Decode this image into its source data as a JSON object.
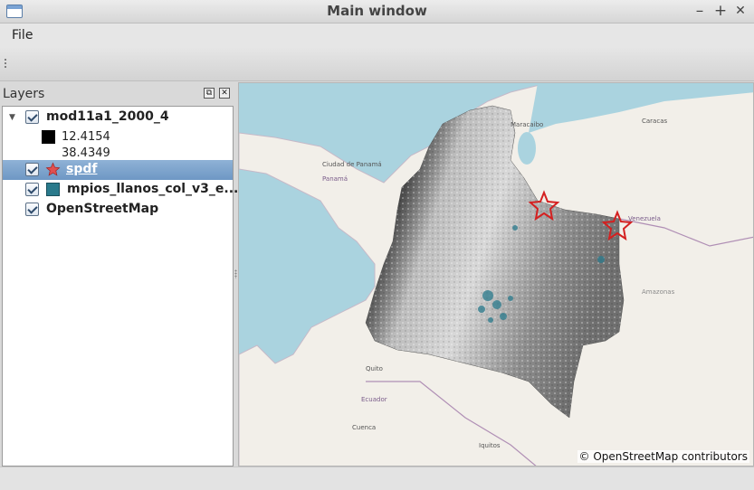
{
  "window": {
    "title": "Main window",
    "minimize": "–",
    "maximize": "+",
    "close": "✕"
  },
  "menu": {
    "file": "File"
  },
  "layers": {
    "title": "Layers",
    "float_btn": "⧉",
    "close_btn": "✕",
    "items": [
      {
        "label": "mod11a1_2000_4",
        "checked": true,
        "expanded": true,
        "legend": [
          {
            "label": "12.4154",
            "color": "#000000"
          },
          {
            "label": "38.4349"
          }
        ]
      },
      {
        "label": "spdf",
        "checked": true,
        "selected": true,
        "icon": "star-icon",
        "color": "#e05050"
      },
      {
        "label": "mpios_llanos_col_v3_e...",
        "checked": true,
        "color": "#2a7a8c"
      },
      {
        "label": "OpenStreetMap",
        "checked": true
      }
    ]
  },
  "map": {
    "attribution": "© OpenStreetMap contributors",
    "colors": {
      "sea": "#aad3df",
      "land": "#f2efe9",
      "star": "#d42020"
    },
    "place_labels": [
      "Maracaibo",
      "Caracas",
      "Ciudad de Panamá",
      "Panamá",
      "Venezuela",
      "Quito",
      "Ecuador",
      "Iquitos",
      "Cuenca",
      "Amazonas"
    ]
  }
}
